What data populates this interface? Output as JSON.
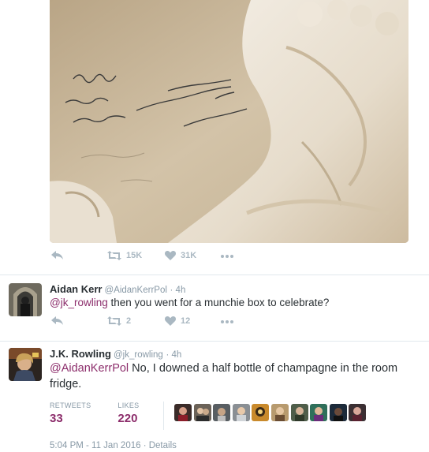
{
  "top_tweet": {
    "retweets": "15K",
    "likes": "31K"
  },
  "reply_tweet": {
    "name": "Aidan Kerr",
    "handle": "@AidanKerrPol",
    "time": "· 4h",
    "mention": "@jk_rowling",
    "text": " then you went for a munchie box to celebrate?",
    "retweets": "2",
    "likes": "12"
  },
  "main_tweet": {
    "name": "J.K. Rowling",
    "handle": "@jk_rowling",
    "time": "· 4h",
    "mention": "@AidanKerrPol",
    "text": " No, I downed a half bottle of champagne in the room fridge.",
    "retweets_label": "RETWEETS",
    "retweets": "33",
    "likes_label": "LIKES",
    "likes": "220",
    "timestamp": "5:04 PM - 11 Jan 2016",
    "details_link": "Details"
  },
  "colors": {
    "mention": "#8c2d6b",
    "muted": "#8899a6",
    "action": "#aab8c2",
    "text": "#292f33"
  }
}
